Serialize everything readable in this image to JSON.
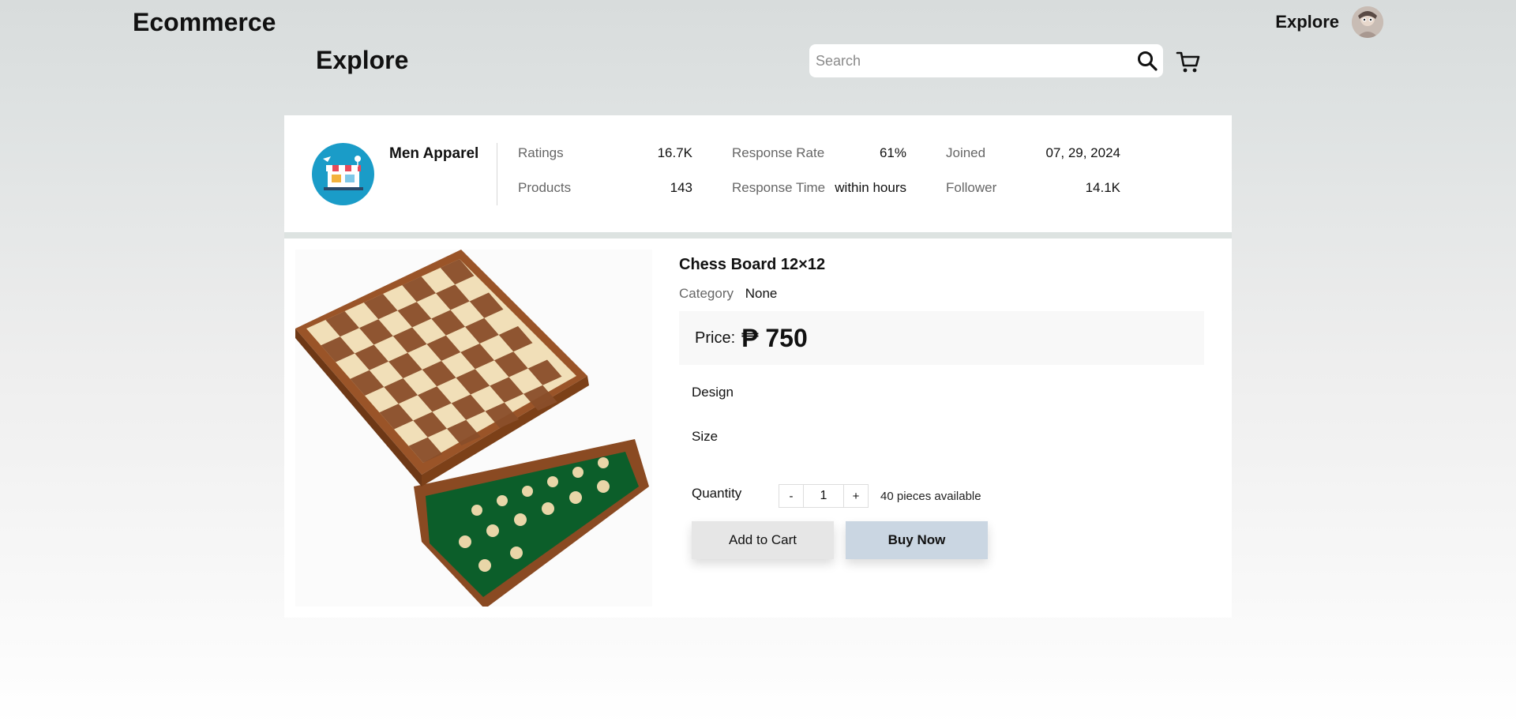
{
  "header": {
    "brand": "Ecommerce",
    "nav_explore": "Explore",
    "page_title": "Explore",
    "search_placeholder": "Search"
  },
  "shop": {
    "name": "Men Apparel",
    "stats": [
      {
        "label": "Ratings",
        "value": "16.7K"
      },
      {
        "label": "Response Rate",
        "value": "61%"
      },
      {
        "label": "Joined",
        "value": "07, 29, 2024"
      },
      {
        "label": "Products",
        "value": "143"
      },
      {
        "label": "Response Time",
        "value": "within hours"
      },
      {
        "label": "Follower",
        "value": "14.1K"
      }
    ]
  },
  "product": {
    "title": "Chess Board 12×12",
    "category_label": "Category",
    "category_value": "None",
    "price_label": "Price:",
    "price_value": "₱ 750",
    "design_label": "Design",
    "size_label": "Size",
    "quantity_label": "Quantity",
    "quantity_minus": "-",
    "quantity_value": "1",
    "quantity_plus": "+",
    "available": "40 pieces available",
    "add_to_cart": "Add to Cart",
    "buy_now": "Buy Now"
  },
  "colors": {
    "shop_logo_bg": "#1a9cc8",
    "buy_now_bg": "#cad6e2",
    "add_cart_bg": "#e6e6e6"
  },
  "icons": {
    "search": "search-icon",
    "cart": "cart-icon",
    "avatar": "avatar-icon",
    "shop_logo": "shop-storefront-icon"
  }
}
